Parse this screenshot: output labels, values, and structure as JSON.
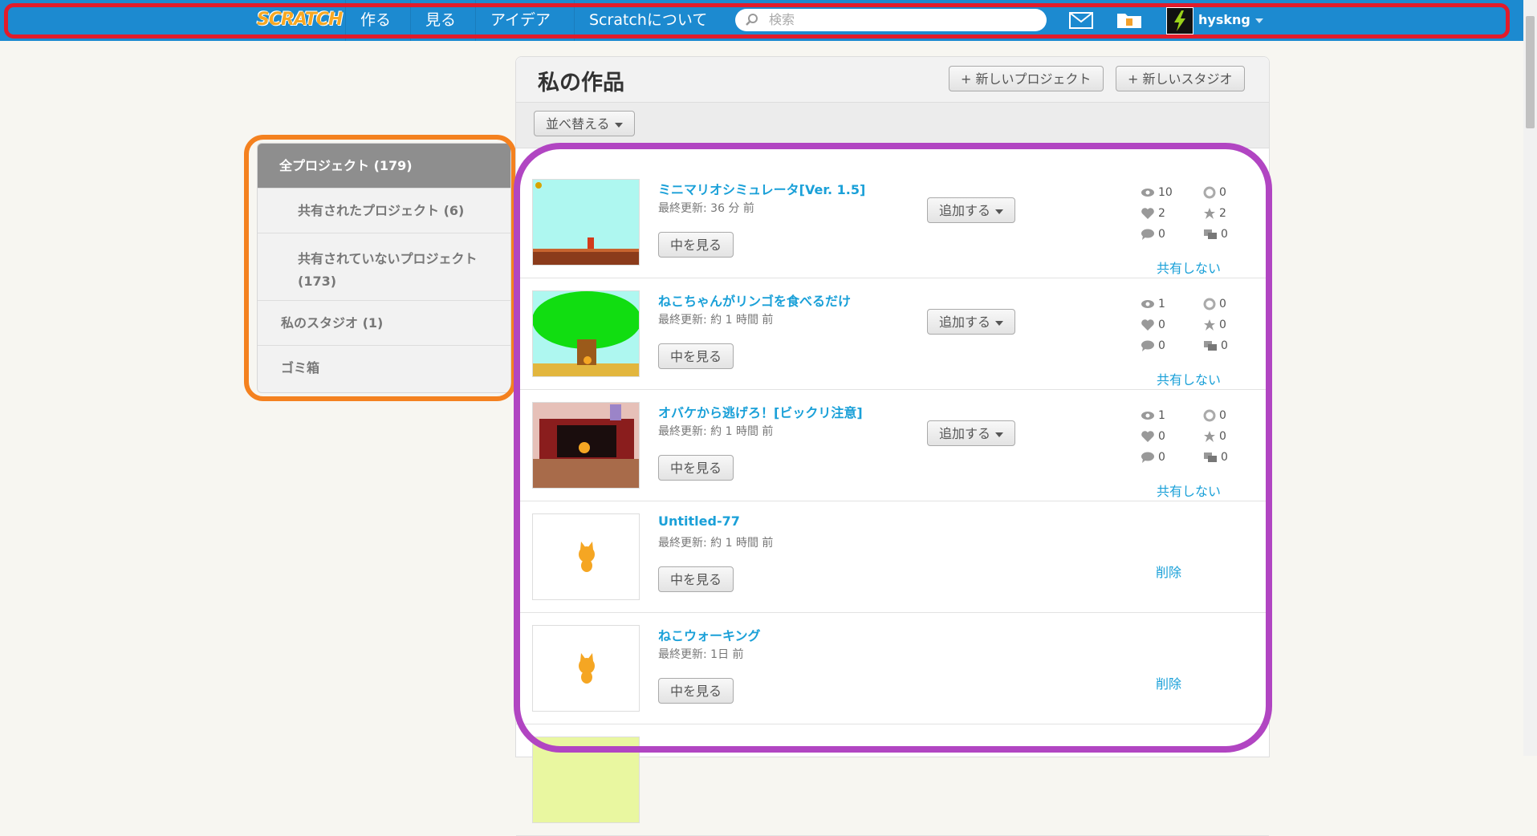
{
  "topbar": {
    "logo": "SCRATCH",
    "nav": [
      "作る",
      "見る",
      "アイデア",
      "Scratchについて"
    ],
    "search_placeholder": "検索",
    "username": "hyskng"
  },
  "sidebar": {
    "items": [
      {
        "label": "全プロジェクト",
        "count": "(179)"
      },
      {
        "label": "共有されたプロジェクト",
        "count": "(6)"
      },
      {
        "label": "共有されていないプロジェクト",
        "count": "(173)"
      },
      {
        "label": "私のスタジオ",
        "count": "(1)"
      },
      {
        "label": "ゴミ箱",
        "count": ""
      }
    ]
  },
  "main": {
    "title": "私の作品",
    "new_project": "+ 新しいプロジェクト",
    "new_studio": "+ 新しいスタジオ",
    "sort_label": "並べ替える",
    "view_label": "中を見る",
    "add_label": "追加する",
    "unshare_label": "共有しない",
    "delete_label": "削除",
    "projects": [
      {
        "title": "ミニマリオシミュレータ[Ver. 1.5]",
        "updated": "最終更新: 36 分 前",
        "shared": true,
        "stats": {
          "views": "10",
          "remixes": "0",
          "loves": "2",
          "favorites": "2",
          "comments": "0",
          "studios": "0"
        }
      },
      {
        "title": "ねこちゃんがリンゴを食べるだけ",
        "updated": "最終更新: 約 1 時間 前",
        "shared": true,
        "stats": {
          "views": "1",
          "remixes": "0",
          "loves": "0",
          "favorites": "0",
          "comments": "0",
          "studios": "0"
        }
      },
      {
        "title": "オバケから逃げろ！[ビックリ注意]",
        "updated": "最終更新: 約 1 時間 前",
        "shared": true,
        "stats": {
          "views": "1",
          "remixes": "0",
          "loves": "0",
          "favorites": "0",
          "comments": "0",
          "studios": "0"
        }
      },
      {
        "title": "Untitled-77",
        "updated": "最終更新: 約 1 時間 前",
        "shared": false
      },
      {
        "title": "ねこウォーキング",
        "updated": "最終更新: 1日 前",
        "shared": false
      }
    ]
  }
}
